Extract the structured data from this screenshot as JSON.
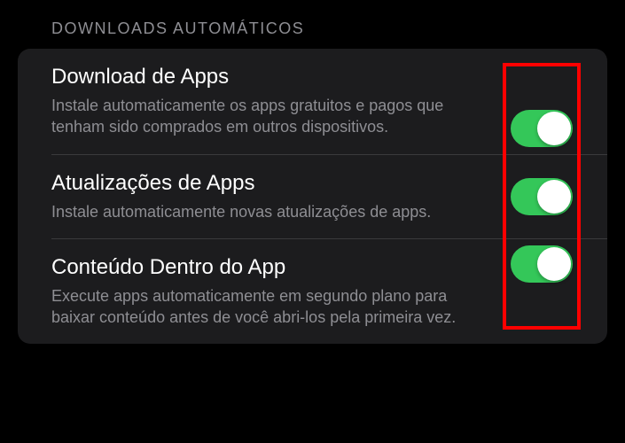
{
  "section": {
    "header": "DOWNLOADS AUTOMÁTICOS",
    "items": [
      {
        "title": "Download de Apps",
        "description": "Instale automaticamente os apps gratuitos e pagos que tenham sido comprados em outros dispositivos.",
        "enabled": true
      },
      {
        "title": "Atualizações de Apps",
        "description": "Instale automaticamente novas atualizações de apps.",
        "enabled": true
      },
      {
        "title": "Conteúdo Dentro do App",
        "description": "Execute apps automaticamente em segundo plano para baixar conteúdo antes de você abri-los pela primeira vez.",
        "enabled": true
      }
    ]
  },
  "colors": {
    "toggle_on": "#34c759",
    "highlight_border": "#ff0000"
  }
}
